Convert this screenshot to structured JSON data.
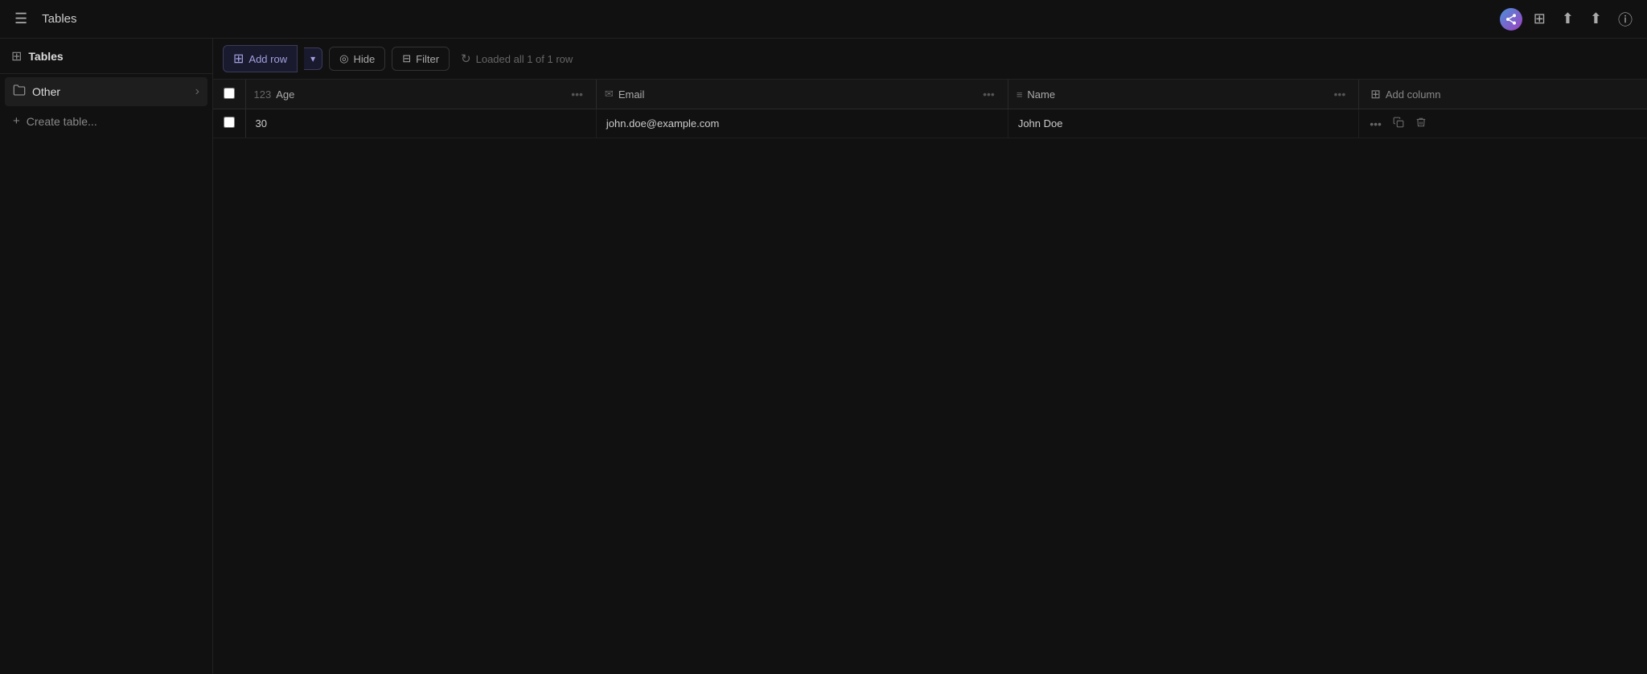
{
  "app": {
    "brand_icon": "share",
    "brand_icon_unicode": "⤢"
  },
  "topbar": {
    "menu_icon": "☰",
    "tables_label": "Tables",
    "view_toggle_icon": "▦",
    "export_icon": "↑",
    "share_icon": "⤢",
    "info_icon": "ⓘ"
  },
  "sidebar": {
    "header_label": "Tables",
    "group": {
      "label": "Other",
      "icon": "folder",
      "expand_icon": "›"
    },
    "create_label": "Create table...",
    "create_icon": "+"
  },
  "toolbar": {
    "add_row_label": "Add row",
    "add_row_icon": "+",
    "hide_label": "Hide",
    "hide_icon": "⊘",
    "filter_label": "Filter",
    "filter_icon": "⊟",
    "status_icon": "↻",
    "status_text": "Loaded all 1 of 1 row"
  },
  "table": {
    "columns": [
      {
        "id": "age",
        "type_icon": "123",
        "label": "Age"
      },
      {
        "id": "email",
        "type_icon": "✉",
        "label": "Email"
      },
      {
        "id": "name",
        "type_icon": "≡",
        "label": "Name"
      }
    ],
    "add_column_label": "Add column",
    "rows": [
      {
        "id": 1,
        "age": "30",
        "email": "john.doe@example.com",
        "name": "John Doe"
      }
    ]
  }
}
